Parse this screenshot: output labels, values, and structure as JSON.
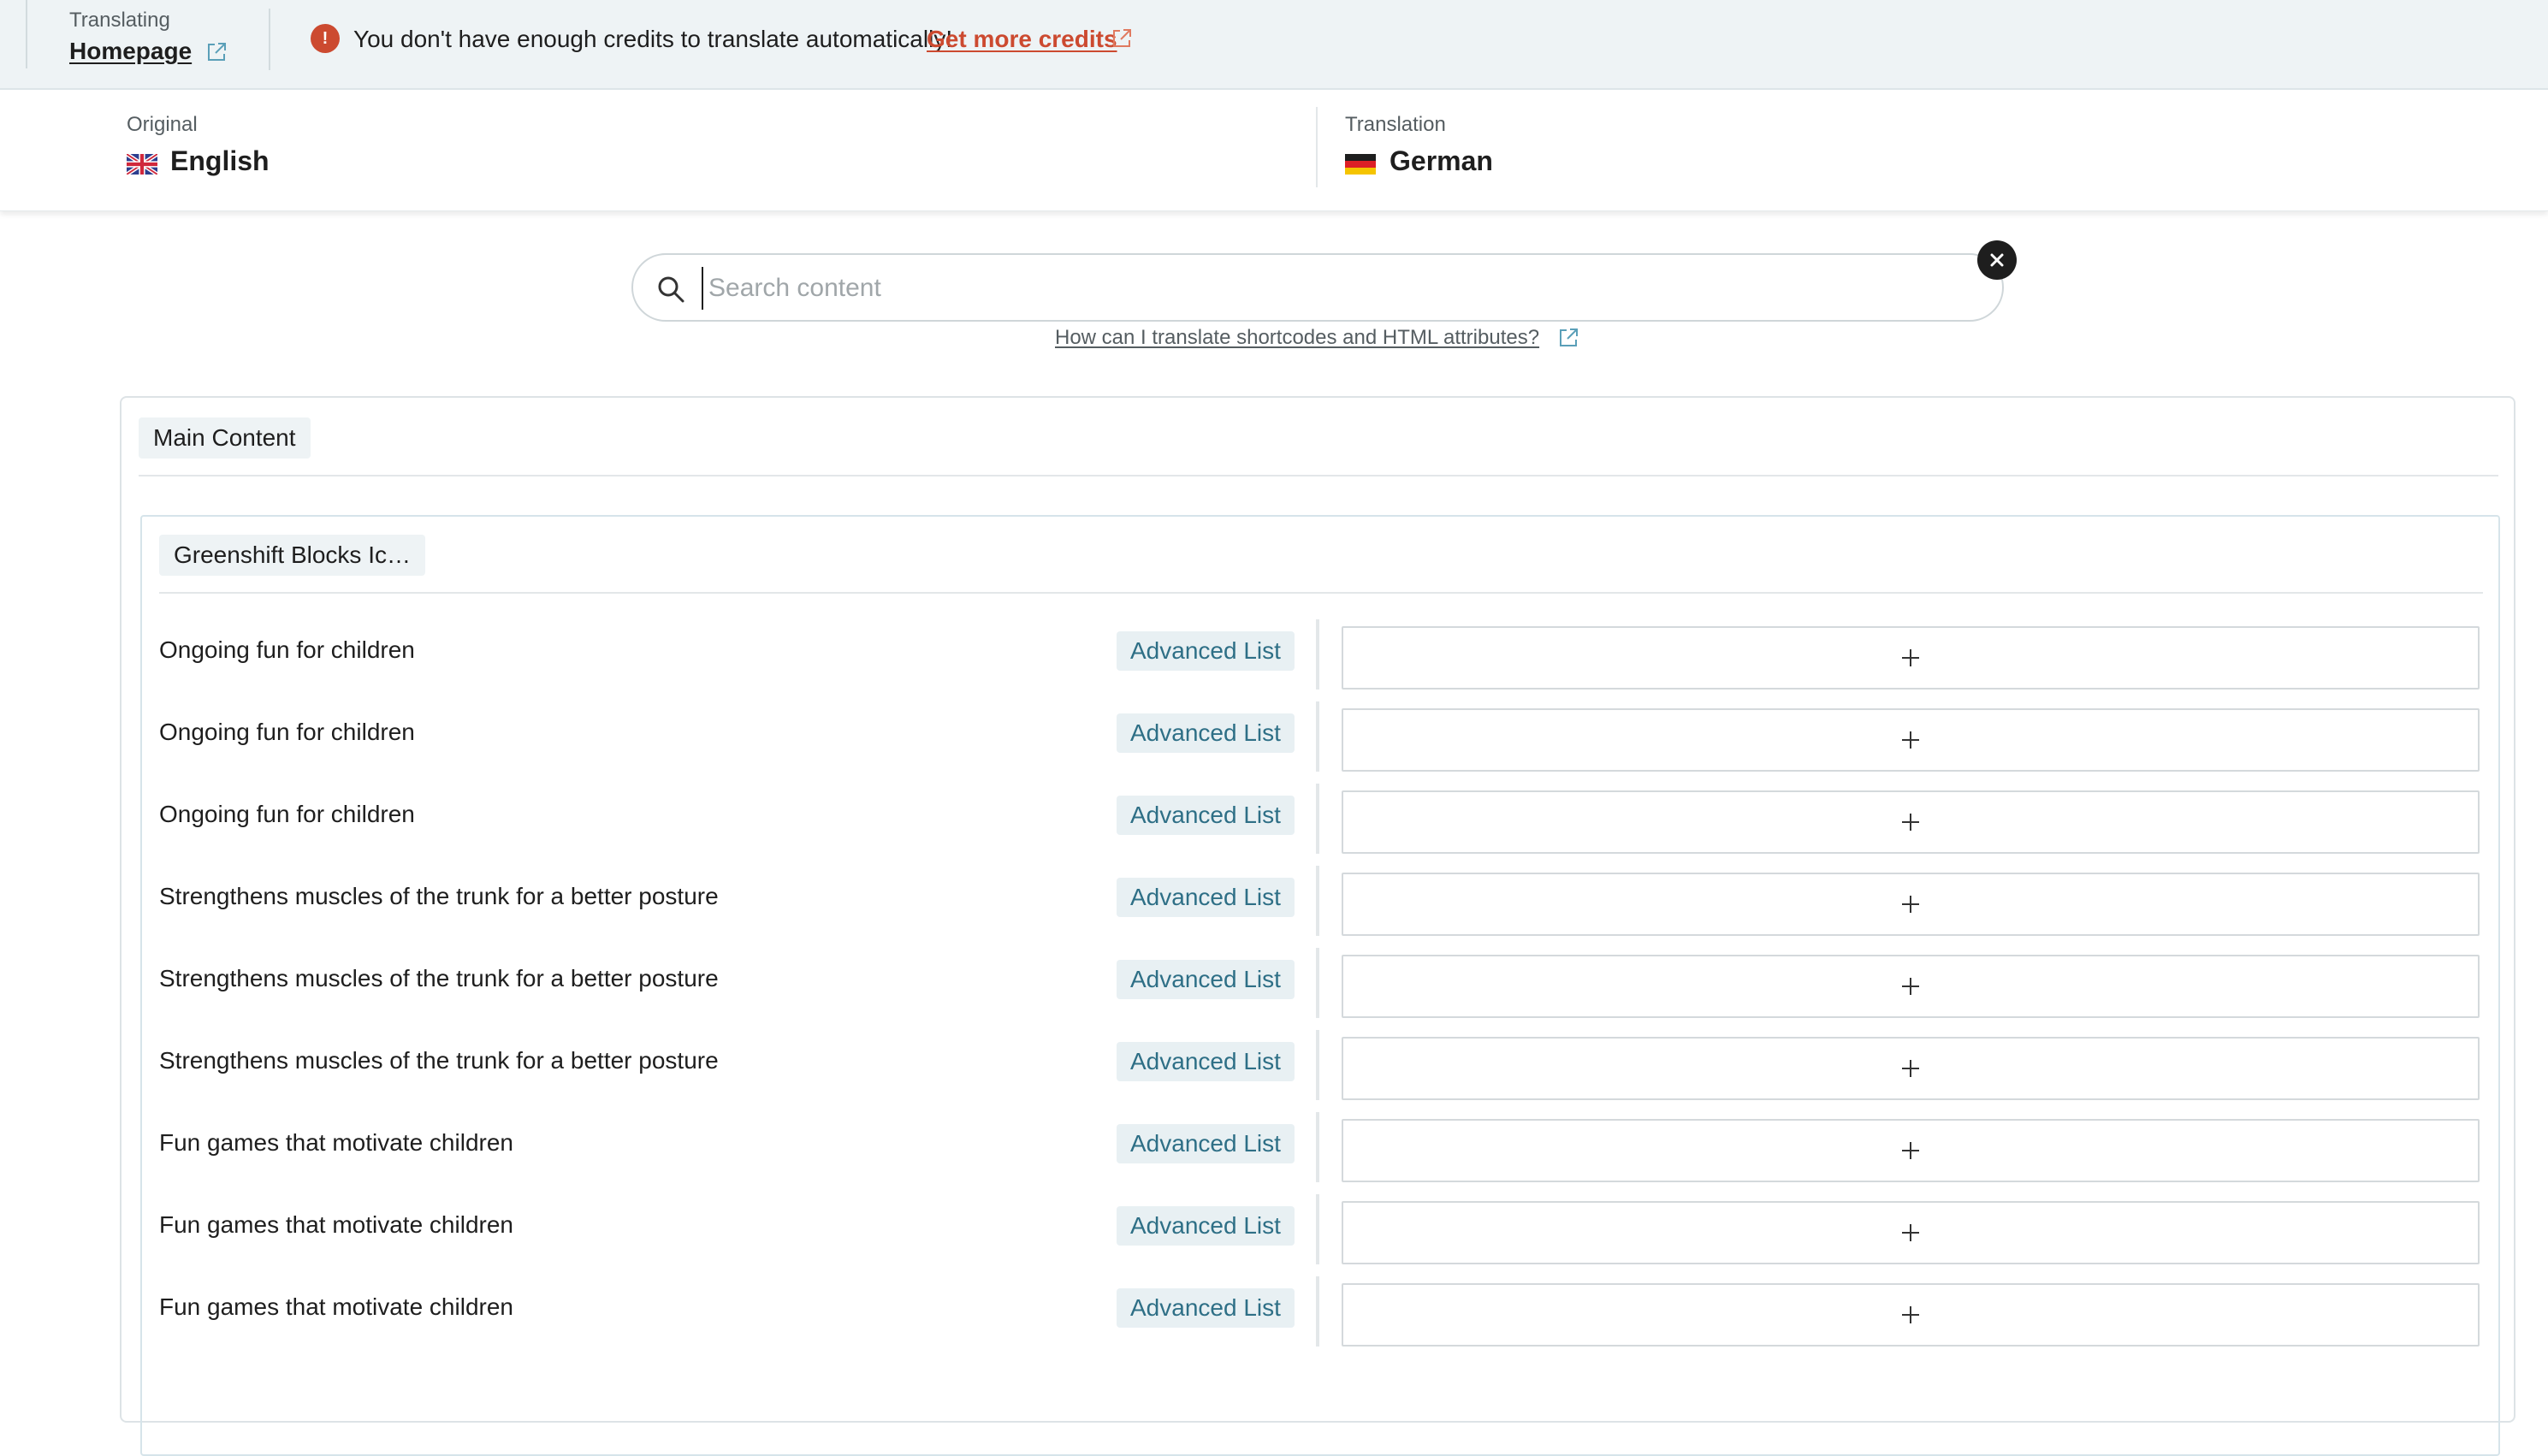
{
  "topbar": {
    "translating_label": "Translating",
    "page_link": "Homepage",
    "warning_text": "You don't have enough credits to translate automatically!",
    "credits_link": "Get more credits",
    "warning_icon": "!"
  },
  "languages": {
    "original_label": "Original",
    "original_name": "English",
    "original_flag": "uk-flag-icon",
    "translation_label": "Translation",
    "translation_name": "German",
    "translation_flag": "german-flag-icon"
  },
  "search": {
    "placeholder": "Search content",
    "value": "",
    "clear_icon": "close-icon",
    "help_link": "How can I translate shortcodes and HTML attributes?"
  },
  "main": {
    "section_chip": "Main Content",
    "block_chip": "Greenshift Blocks Ic…",
    "rows": [
      {
        "text": "Ongoing fun for children",
        "badge": "Advanced List"
      },
      {
        "text": "Ongoing fun for children",
        "badge": "Advanced List"
      },
      {
        "text": "Ongoing fun for children",
        "badge": "Advanced List"
      },
      {
        "text": "Strengthens muscles of the trunk for a better posture",
        "badge": "Advanced List"
      },
      {
        "text": "Strengthens muscles of the trunk for a better posture",
        "badge": "Advanced List"
      },
      {
        "text": "Strengthens muscles of the trunk for a better posture",
        "badge": "Advanced List"
      },
      {
        "text": "Fun games that motivate children",
        "badge": "Advanced List"
      },
      {
        "text": "Fun games that motivate children",
        "badge": "Advanced List"
      },
      {
        "text": "Fun games that motivate children",
        "badge": "Advanced List"
      }
    ]
  },
  "colors": {
    "accent": "#cc4a30",
    "badge_text": "#2e6f86",
    "topbar_bg": "#eef3f5"
  }
}
